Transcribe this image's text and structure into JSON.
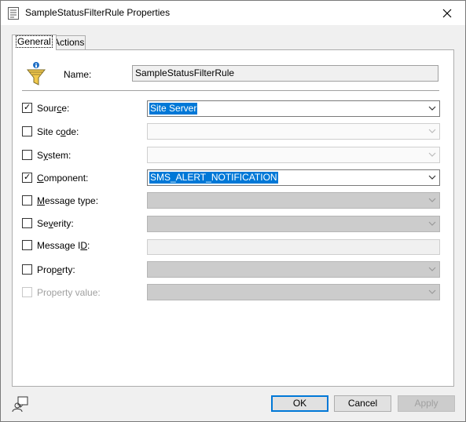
{
  "window": {
    "title": "SampleStatusFilterRule Properties",
    "icon": "properties-page-icon",
    "close_icon": "close-icon"
  },
  "tabs": [
    {
      "label": "General",
      "active": true
    },
    {
      "label": "Actions",
      "active": false
    }
  ],
  "general": {
    "rule_icon": "funnel-info-icon",
    "name_label": "Name:",
    "name_value": "SampleStatusFilterRule",
    "rows": {
      "source": {
        "pre": "Sour",
        "acc": "c",
        "post": "e:",
        "checked": true,
        "value": "Site Server"
      },
      "site_code": {
        "pre": "Site c",
        "acc": "o",
        "post": "de:",
        "checked": false,
        "value": ""
      },
      "system": {
        "pre": "S",
        "acc": "y",
        "post": "stem:",
        "checked": false,
        "value": ""
      },
      "component": {
        "pre": "",
        "acc": "C",
        "post": "omponent:",
        "checked": true,
        "value": "SMS_ALERT_NOTIFICATION"
      },
      "message_type": {
        "pre": "",
        "acc": "M",
        "post": "essage type:",
        "checked": false,
        "value": ""
      },
      "severity": {
        "pre": "Se",
        "acc": "v",
        "post": "erity:",
        "checked": false,
        "value": ""
      },
      "message_id": {
        "pre": "Message I",
        "acc": "D",
        "post": ":",
        "checked": false,
        "value": ""
      },
      "property": {
        "pre": "Prop",
        "acc": "e",
        "post": "rty:",
        "checked": false,
        "value": ""
      },
      "property_value": {
        "label": "Property value:",
        "checked": false,
        "value": ""
      }
    }
  },
  "footer": {
    "ok_label": "OK",
    "cancel_label": "Cancel",
    "apply_label": "Apply",
    "help_icon": "context-help-icon"
  },
  "colors": {
    "accent": "#0078d7",
    "disabled_text": "#a0a0a0"
  }
}
